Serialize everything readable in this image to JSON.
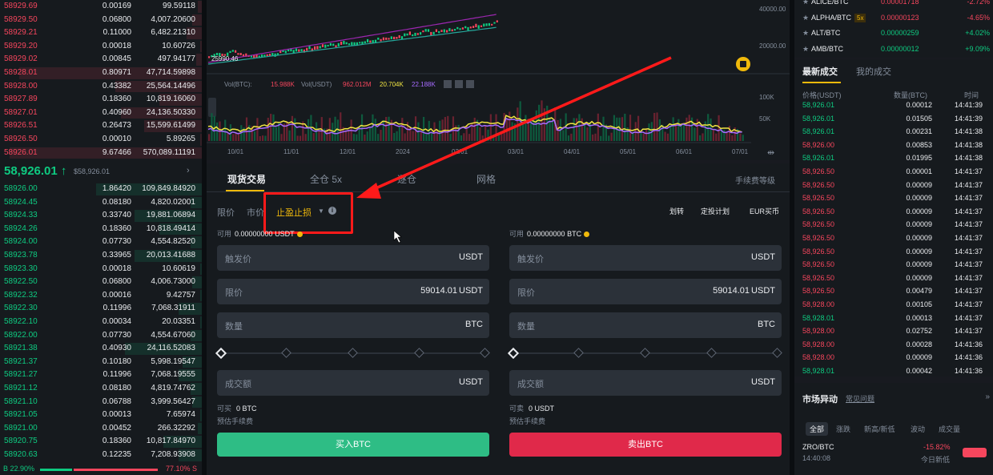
{
  "orderbook": {
    "asks": [
      {
        "price": "58929.69",
        "qty": "0.00169",
        "total": "99.59118",
        "depth": 0.02
      },
      {
        "price": "58929.50",
        "qty": "0.06800",
        "total": "4,007.20600",
        "depth": 0.05
      },
      {
        "price": "58929.21",
        "qty": "0.11000",
        "total": "6,482.21310",
        "depth": 0.08
      },
      {
        "price": "58929.20",
        "qty": "0.00018",
        "total": "10.60726",
        "depth": 0.01
      },
      {
        "price": "58929.02",
        "qty": "0.00845",
        "total": "497.94177",
        "depth": 0.03
      },
      {
        "price": "58928.01",
        "qty": "0.80971",
        "total": "47,714.59898",
        "depth": 0.95
      },
      {
        "price": "58928.00",
        "qty": "0.43382",
        "total": "25,564.14496",
        "depth": 0.45
      },
      {
        "price": "58927.89",
        "qty": "0.18360",
        "total": "10,819.16060",
        "depth": 0.22
      },
      {
        "price": "58927.01",
        "qty": "0.40960",
        "total": "24,136.50330",
        "depth": 0.42
      },
      {
        "price": "58926.51",
        "qty": "0.26473",
        "total": "15,599.61499",
        "depth": 0.3
      },
      {
        "price": "58926.50",
        "qty": "0.00010",
        "total": "5.89265",
        "depth": 0.01
      },
      {
        "price": "58926.01",
        "qty": "9.67466",
        "total": "570,089.11191",
        "depth": 1.0
      }
    ],
    "mid": {
      "price": "58,926.01",
      "arrow": "↑",
      "sub": "$58,926.01",
      "chevron": "›"
    },
    "bids": [
      {
        "price": "58926.00",
        "qty": "1.86420",
        "total": "109,849.84920",
        "depth": 0.55
      },
      {
        "price": "58924.45",
        "qty": "0.08180",
        "total": "4,820.02001",
        "depth": 0.06
      },
      {
        "price": "58924.33",
        "qty": "0.33740",
        "total": "19,881.06894",
        "depth": 0.35
      },
      {
        "price": "58924.26",
        "qty": "0.18360",
        "total": "10,818.49414",
        "depth": 0.22
      },
      {
        "price": "58924.00",
        "qty": "0.07730",
        "total": "4,554.82520",
        "depth": 0.06
      },
      {
        "price": "58923.78",
        "qty": "0.33965",
        "total": "20,013.41688",
        "depth": 0.35
      },
      {
        "price": "58923.30",
        "qty": "0.00018",
        "total": "10.60619",
        "depth": 0.01
      },
      {
        "price": "58922.50",
        "qty": "0.06800",
        "total": "4,006.73000",
        "depth": 0.05
      },
      {
        "price": "58922.32",
        "qty": "0.00016",
        "total": "9.42757",
        "depth": 0.01
      },
      {
        "price": "58922.30",
        "qty": "0.11996",
        "total": "7,068.31911",
        "depth": 0.12
      },
      {
        "price": "58922.10",
        "qty": "0.00034",
        "total": "20.03351",
        "depth": 0.01
      },
      {
        "price": "58922.00",
        "qty": "0.07730",
        "total": "4,554.67060",
        "depth": 0.06
      },
      {
        "price": "58921.38",
        "qty": "0.40930",
        "total": "24,116.52083",
        "depth": 0.4
      },
      {
        "price": "58921.37",
        "qty": "0.10180",
        "total": "5,998.19547",
        "depth": 0.1
      },
      {
        "price": "58921.27",
        "qty": "0.11996",
        "total": "7,068.19555",
        "depth": 0.12
      },
      {
        "price": "58921.12",
        "qty": "0.08180",
        "total": "4,819.74762",
        "depth": 0.06
      },
      {
        "price": "58921.10",
        "qty": "0.06788",
        "total": "3,999.56427",
        "depth": 0.05
      },
      {
        "price": "58921.05",
        "qty": "0.00013",
        "total": "7.65974",
        "depth": 0.01
      },
      {
        "price": "58921.00",
        "qty": "0.00452",
        "total": "266.32292",
        "depth": 0.02
      },
      {
        "price": "58920.75",
        "qty": "0.18360",
        "total": "10,817.84970",
        "depth": 0.2
      },
      {
        "price": "58920.63",
        "qty": "0.12235",
        "total": "7,208.93908",
        "depth": 0.12
      }
    ],
    "ratio": {
      "buy": "B 22.90%",
      "sell": "77.10% S"
    }
  },
  "chart": {
    "price_labels": [
      "40000.00",
      "20000.00"
    ],
    "low_label": "25990.46",
    "vol_legend": {
      "label1": "Vol(BTC):",
      "v1": "15.988K",
      "label2": "Vol(USDT)",
      "v2": "962.012M",
      "v3": "20.704K",
      "v4": "22.188K"
    },
    "vol_axis": [
      "100K",
      "50K"
    ],
    "dates": [
      "10/01",
      "11/01",
      "12/01",
      "2024",
      "02/01",
      "03/01",
      "04/01",
      "05/01",
      "06/01",
      "07/01"
    ]
  },
  "trade_panel": {
    "tabs": [
      "现货交易",
      "全仓 5x",
      "逐仓",
      "网格"
    ],
    "fee_link": "手续费等级",
    "order_types": [
      "限价",
      "市价",
      "止盈止损"
    ],
    "tools": [
      "划转",
      "定投计划",
      "EUR买币"
    ],
    "buy": {
      "avail_label": "可用",
      "avail_value": "0.00000000 USDT",
      "trigger_label": "触发价",
      "trigger_unit": "USDT",
      "limit_label": "限价",
      "limit_value": "59014.01",
      "limit_unit": "USDT",
      "qty_label": "数量",
      "qty_unit": "BTC",
      "amount_label": "成交额",
      "amount_unit": "USDT",
      "can_label": "可买",
      "can_value": "0 BTC",
      "fee_label": "预估手续费",
      "button": "买入BTC"
    },
    "sell": {
      "avail_label": "可用",
      "avail_value": "0.00000000 BTC",
      "trigger_label": "触发价",
      "trigger_unit": "USDT",
      "limit_label": "限价",
      "limit_value": "59014.01",
      "limit_unit": "USDT",
      "qty_label": "数量",
      "qty_unit": "BTC",
      "amount_label": "成交额",
      "amount_unit": "USDT",
      "can_label": "可卖",
      "can_value": "0 USDT",
      "fee_label": "预估手续费",
      "button": "卖出BTC"
    }
  },
  "markets": [
    {
      "pair": "ALICE/BTC",
      "lev": "",
      "price": "0.00001718",
      "change": "-2.72%",
      "up": false
    },
    {
      "pair": "ALPHA/BTC",
      "lev": "5x",
      "price": "0.00000123",
      "change": "-4.65%",
      "up": false
    },
    {
      "pair": "ALT/BTC",
      "lev": "",
      "price": "0.00000259",
      "change": "+4.02%",
      "up": true
    },
    {
      "pair": "AMB/BTC",
      "lev": "",
      "price": "0.00000012",
      "change": "+9.09%",
      "up": true
    }
  ],
  "trades": {
    "tabs": [
      "最新成交",
      "我的成交"
    ],
    "headers": [
      "价格(USDT)",
      "数量(BTC)",
      "时间"
    ],
    "rows": [
      {
        "price": "58,926.01",
        "qty": "0.00012",
        "time": "14:41:39",
        "up": true
      },
      {
        "price": "58,926.01",
        "qty": "0.01505",
        "time": "14:41:39",
        "up": true
      },
      {
        "price": "58,926.01",
        "qty": "0.00231",
        "time": "14:41:38",
        "up": true
      },
      {
        "price": "58,926.00",
        "qty": "0.00853",
        "time": "14:41:38",
        "up": false
      },
      {
        "price": "58,926.01",
        "qty": "0.01995",
        "time": "14:41:38",
        "up": true
      },
      {
        "price": "58,926.50",
        "qty": "0.00001",
        "time": "14:41:37",
        "up": false
      },
      {
        "price": "58,926.50",
        "qty": "0.00009",
        "time": "14:41:37",
        "up": false
      },
      {
        "price": "58,926.50",
        "qty": "0.00009",
        "time": "14:41:37",
        "up": false
      },
      {
        "price": "58,926.50",
        "qty": "0.00009",
        "time": "14:41:37",
        "up": false
      },
      {
        "price": "58,926.50",
        "qty": "0.00009",
        "time": "14:41:37",
        "up": false
      },
      {
        "price": "58,926.50",
        "qty": "0.00009",
        "time": "14:41:37",
        "up": false
      },
      {
        "price": "58,926.50",
        "qty": "0.00009",
        "time": "14:41:37",
        "up": false
      },
      {
        "price": "58,926.50",
        "qty": "0.00009",
        "time": "14:41:37",
        "up": false
      },
      {
        "price": "58,926.50",
        "qty": "0.00009",
        "time": "14:41:37",
        "up": false
      },
      {
        "price": "58,926.50",
        "qty": "0.00479",
        "time": "14:41:37",
        "up": false
      },
      {
        "price": "58,928.00",
        "qty": "0.00105",
        "time": "14:41:37",
        "up": false
      },
      {
        "price": "58,928.01",
        "qty": "0.00013",
        "time": "14:41:37",
        "up": true
      },
      {
        "price": "58,928.00",
        "qty": "0.02752",
        "time": "14:41:37",
        "up": false
      },
      {
        "price": "58,928.00",
        "qty": "0.00028",
        "time": "14:41:36",
        "up": false
      },
      {
        "price": "58,928.00",
        "qty": "0.00009",
        "time": "14:41:36",
        "up": false
      },
      {
        "price": "58,928.01",
        "qty": "0.00042",
        "time": "14:41:36",
        "up": true
      }
    ]
  },
  "movers": {
    "title": "市场异动",
    "faq": "常见问题",
    "collapse": "»",
    "tabs": [
      "全部",
      "涨跌",
      "新高/新低",
      "波动",
      "成交量"
    ],
    "item": {
      "pair": "ZRO/BTC",
      "time": "14:40:08",
      "change": "-15.82%",
      "desc": "今日新低"
    }
  },
  "colors": {
    "up": "#0ecb81",
    "down": "#f6465d",
    "accent": "#f0b90b",
    "highlight": "#ff1a1a"
  }
}
